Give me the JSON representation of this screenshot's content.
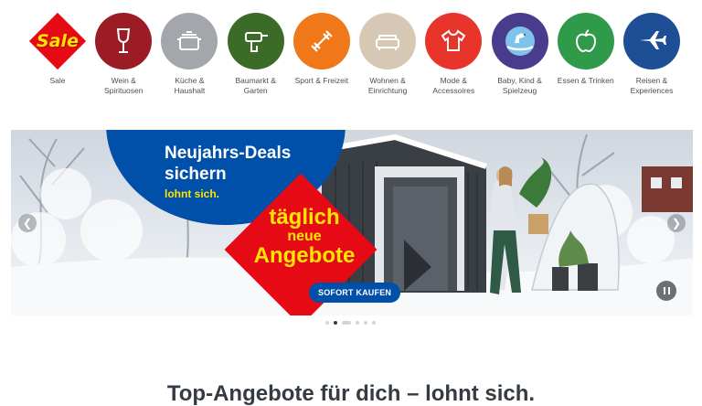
{
  "categories": [
    {
      "label": "Sale",
      "icon": "sale-badge-icon",
      "color": "#e60a14"
    },
    {
      "label": "Wein &\nSpirituosen",
      "icon": "wine-glass-icon",
      "color": "#9b1c24"
    },
    {
      "label": "Küche &\nHaushalt",
      "icon": "cooking-pot-icon",
      "color": "#a3a6aa"
    },
    {
      "label": "Baumarkt &\nGarten",
      "icon": "drill-icon",
      "color": "#3c6b28"
    },
    {
      "label": "Sport & Freizeit",
      "icon": "dumbbell-icon",
      "color": "#f07818"
    },
    {
      "label": "Wohnen &\nEinrichtung",
      "icon": "sofa-icon",
      "color": "#d6c8b4"
    },
    {
      "label": "Mode &\nAccessoires",
      "icon": "tshirt-icon",
      "color": "#e8352c"
    },
    {
      "label": "Baby, Kind &\nSpielzeug",
      "icon": "rocking-horse-icon",
      "color": "#4a3c8c"
    },
    {
      "label": "Essen & Trinken",
      "icon": "apple-icon",
      "color": "#2e9a4a"
    },
    {
      "label": "Reisen &\nExperiences",
      "icon": "airplane-icon",
      "color": "#1e4f96"
    }
  ],
  "hero": {
    "headline_line1": "Neujahrs-Deals",
    "headline_line2": "sichern",
    "tagline": "lohnt sich.",
    "promo_line1": "täglich",
    "promo_line2": "neue",
    "promo_line3": "Angebote",
    "cta_label": "SOFORT KAUFEN",
    "brand_blue": "#0050aa",
    "brand_red": "#e60a14",
    "brand_yellow": "#ffe500"
  },
  "carousel": {
    "slide_count": 6,
    "active_index": 1
  },
  "section": {
    "heading": "Top-Angebote für dich – lohnt sich."
  }
}
